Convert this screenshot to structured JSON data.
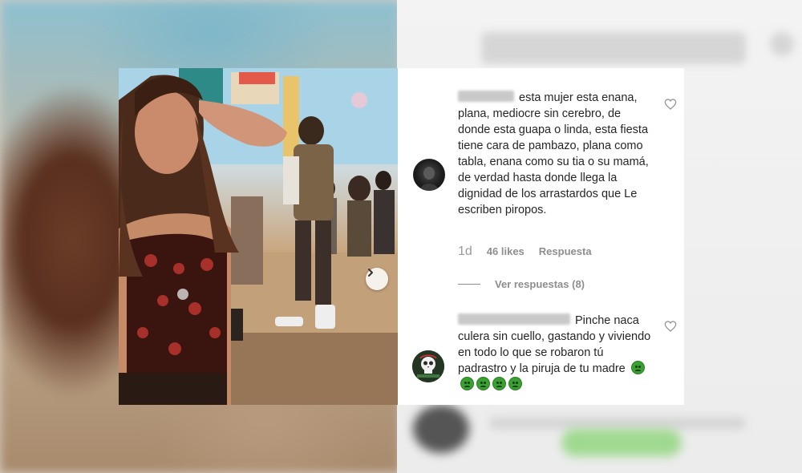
{
  "comments": [
    {
      "username_hidden": true,
      "text": "esta mujer esta enana, plana, mediocre sin cerebro, de donde esta guapa o linda, esta fiesta tiene cara de pambazo, plana como tabla, enana como su tia o su mamá, de verdad hasta donde llega la dignidad de los arrastardos que Le escriben piropos.",
      "age": "1d",
      "likes": "46 likes",
      "reply_label": "Respuesta",
      "view_replies": "Ver respuestas (8)",
      "avatar_icon": "dark-avatar",
      "like_icon": "heart-outline-icon"
    },
    {
      "username_hidden": true,
      "text": "Pinche naca culera sin cuello, gastando y viviendo en todo lo que se robaron tú padrastro y la piruja de tu madre",
      "emoji_count": 5,
      "emoji_icon": "nauseated-face-icon",
      "avatar_icon": "skull-avatar",
      "like_icon": "heart-outline-icon"
    }
  ],
  "colors": {
    "text": "#262626",
    "secondary": "#8e8e8e",
    "emoji_green": "#3aa032"
  }
}
